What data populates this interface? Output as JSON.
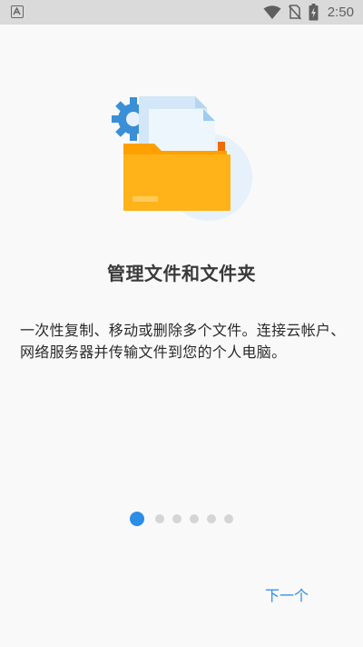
{
  "status_bar": {
    "time": "2:50",
    "icons": [
      "app-notification-icon",
      "wifi-icon",
      "no-sim-icon",
      "battery-charging-icon"
    ]
  },
  "onboarding": {
    "illustration_icon": "folder-with-documents-and-gear-icon",
    "title": "管理文件和文件夹",
    "description": "一次性复制、移动或删除多个文件。连接云帐户、网络服务器并传输文件到您的个人电脑。",
    "page_indicator": {
      "total": 6,
      "current": 1
    },
    "next_label": "下一个"
  },
  "colors": {
    "accent": "#2d8ce6",
    "folder": "#ffb318",
    "gear": "#3a8fd6",
    "dot_inactive": "#d5d5d5"
  }
}
